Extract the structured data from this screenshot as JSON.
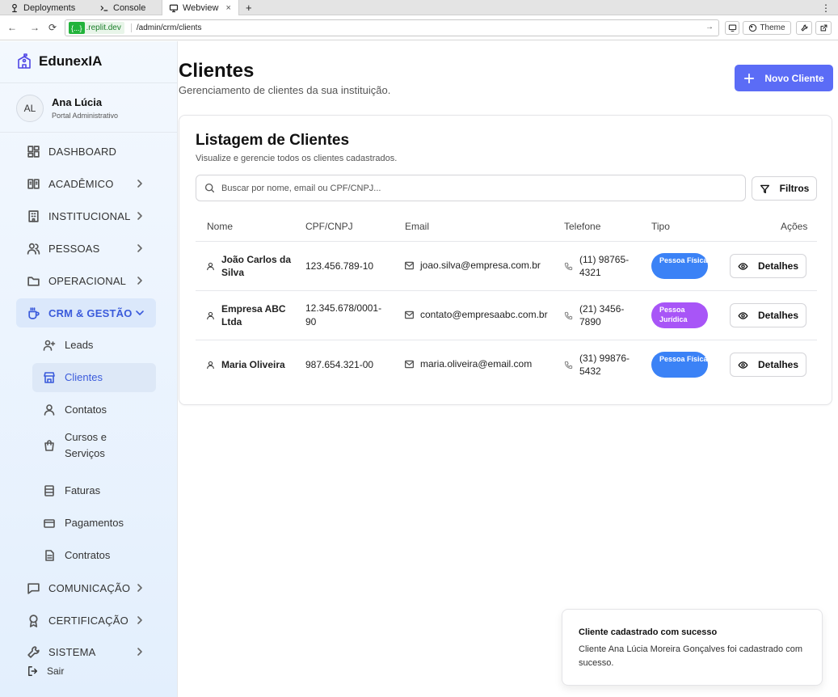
{
  "browser": {
    "tabs": [
      {
        "label": "Deployments",
        "icon": "deployments-icon"
      },
      {
        "label": "Console",
        "icon": "console-icon"
      },
      {
        "label": "Webview",
        "icon": "monitor-icon",
        "active": true
      }
    ],
    "url_badge": "{...}",
    "url_host": ".replit.dev",
    "url_path": "/admin/crm/clients",
    "theme_label": "Theme"
  },
  "sidebar": {
    "brand": "EdunexIA",
    "user": {
      "initials": "AL",
      "name": "Ana Lúcia",
      "role": "Portal Administrativo"
    },
    "items": [
      {
        "label": "DASHBOARD",
        "icon": "dashboard-icon"
      },
      {
        "label": "ACADÊMICO",
        "icon": "book-icon"
      },
      {
        "label": "INSTITUCIONAL",
        "icon": "building-icon"
      },
      {
        "label": "PESSOAS",
        "icon": "users-icon"
      },
      {
        "label": "OPERACIONAL",
        "icon": "folder-icon"
      },
      {
        "label": "CRM & GESTÃO",
        "icon": "coffee-icon",
        "expanded": true
      },
      {
        "label": "COMUNICAÇÃO",
        "icon": "message-icon"
      },
      {
        "label": "CERTIFICAÇÃO",
        "icon": "award-icon"
      },
      {
        "label": "SISTEMA",
        "icon": "wrench-icon"
      }
    ],
    "crm_subitems": [
      {
        "label": "Leads",
        "icon": "user-plus-icon"
      },
      {
        "label": "Clientes",
        "icon": "store-icon",
        "active": true
      },
      {
        "label": "Contatos",
        "icon": "user-icon"
      },
      {
        "label": "Cursos e",
        "label2": "Serviços",
        "icon": "shopping-bag-icon"
      },
      {
        "label": "Faturas",
        "icon": "receipt-icon"
      },
      {
        "label": "Pagamentos",
        "icon": "credit-card-icon"
      },
      {
        "label": "Contratos",
        "icon": "file-text-icon"
      }
    ],
    "logout": "Sair"
  },
  "page": {
    "title": "Clientes",
    "subtitle": "Gerenciamento de clientes da sua instituição.",
    "new_button": "Novo Cliente"
  },
  "card": {
    "title": "Listagem de Clientes",
    "subtitle": "Visualize e gerencie todos os clientes cadastrados.",
    "search_placeholder": "Buscar por nome, email ou CPF/CNPJ...",
    "filters_label": "Filtros",
    "columns": [
      "Nome",
      "CPF/CNPJ",
      "Email",
      "Telefone",
      "Tipo",
      "Ações"
    ],
    "details_label": "Detalhes",
    "rows": [
      {
        "name": "João Carlos da Silva",
        "doc": "123.456.789-10",
        "email": "joao.silva@empresa.com.br",
        "phone": "(11) 98765-4321",
        "type": "Pessoa Física",
        "type_color": "#3b82f6"
      },
      {
        "name": "Empresa ABC Ltda",
        "doc": "12.345.678/0001-90",
        "email": "contato@empresaabc.com.br",
        "phone": "(21) 3456-7890",
        "type": "Pessoa Jurídica",
        "type_color": "#a855f7"
      },
      {
        "name": "Maria Oliveira",
        "doc": "987.654.321-00",
        "email": "maria.oliveira@email.com",
        "phone": "(31) 99876-5432",
        "type": "Pessoa Física",
        "type_color": "#3b82f6"
      }
    ]
  },
  "toast": {
    "title": "Cliente cadastrado com sucesso",
    "message": "Cliente Ana Lúcia Moreira Gonçalves foi cadastrado com sucesso."
  },
  "colors": {
    "accent": "#5b6cf6",
    "sidebar_active": "#3b5bdb"
  }
}
